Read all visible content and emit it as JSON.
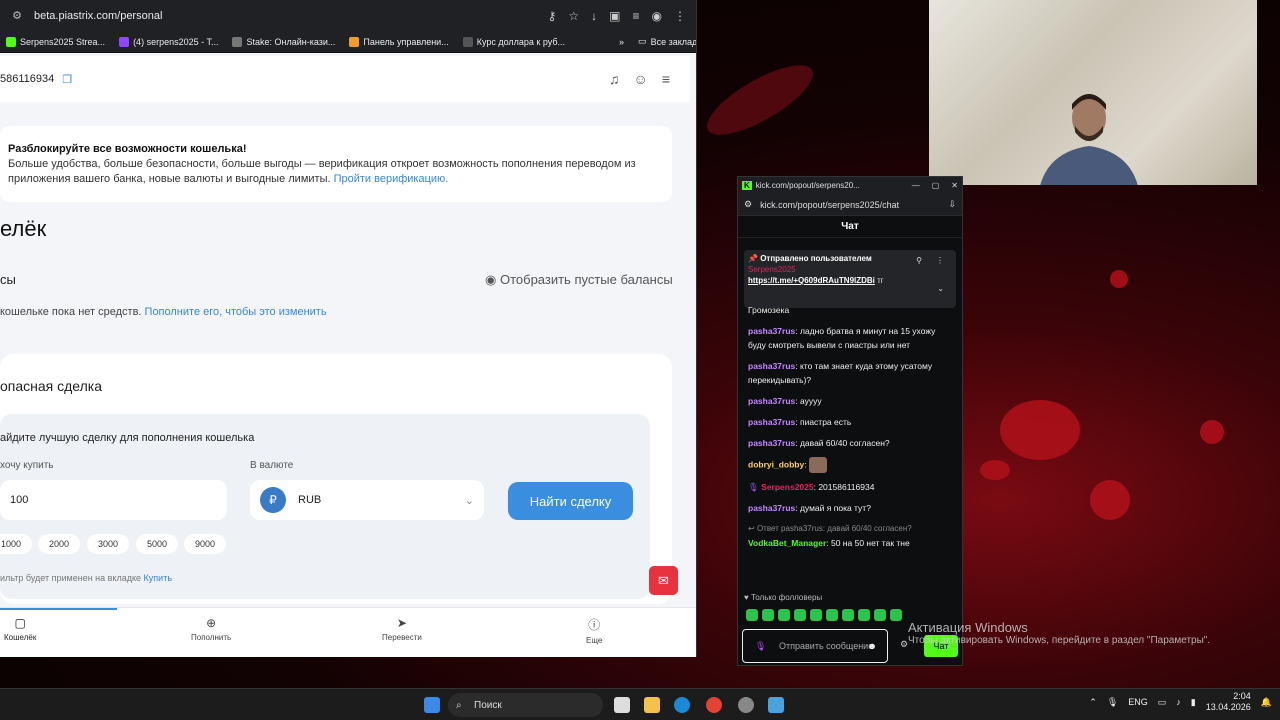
{
  "browser": {
    "url": "beta.piastrix.com/personal",
    "bookmarks": [
      {
        "label": "Serpens2025 Strea...",
        "color": "#53fc18"
      },
      {
        "label": "(4) serpens2025 - T...",
        "color": "#9146ff"
      },
      {
        "label": "Stake: Онлайн-кази...",
        "color": "#1a2c38"
      },
      {
        "label": "Панель управлени...",
        "color": "#f29d2c"
      },
      {
        "label": "Курс доллара к руб...",
        "color": "#333333"
      }
    ],
    "all_bookmarks": "Все закладки"
  },
  "wallet": {
    "account_id": "586116934",
    "banner_title": "Разблокируйте все возможности кошелька!",
    "banner_text": "Больше удобства, больше безопасности, больше выгоды — верификация откроет возможность пополнения переводом из приложения вашего банка, новые валюты и выгодные лимиты.",
    "banner_link": "Пройти верификацию.",
    "heading": "елёк",
    "balances_title": "сы",
    "show_empty": "Отобразить пустые балансы",
    "empty_text": "кошельке пока нет средств.",
    "empty_link": "Пополните его, чтобы это изменить",
    "safe_deal": "опасная сделка",
    "find_best": "айдите лучшую сделку для пополнения кошелька",
    "want_buy": "хочу купить",
    "in_currency": "В валюте",
    "amount": "100",
    "currency": "RUB",
    "find_button": "Найти сделку",
    "chips": [
      "1000",
      "2000",
      "3000",
      "5000",
      "9000"
    ],
    "filter_note": "ильтр будет применен на вкладке",
    "filter_link": "Купить",
    "nav": [
      "Кошелёк",
      "Пополнить",
      "Перевести",
      "Еще"
    ]
  },
  "chat": {
    "window_title": "kick.com/popout/serpens20...",
    "url": "kick.com/popout/serpens2025/chat",
    "header": "Чат",
    "pinned_by": "Отправлено пользователем",
    "pinned_user": "Serpens2025",
    "pinned_link": "https://t.me/+Q609dRAuTN9lZDBi",
    "pinned_suffix": "тг",
    "messages": [
      {
        "user": "",
        "text": "Громозека",
        "color": "#c586ff"
      },
      {
        "user": "pasha37rus",
        "text": ": ладно братва я минут на 15 ухожу буду смотреть вывели с пиастры или нет",
        "color": "#c586ff"
      },
      {
        "user": "pasha37rus",
        "text": ": кто там знает куда этому усатому перекидывать)?",
        "color": "#c586ff"
      },
      {
        "user": "pasha37rus",
        "text": ": ауууу",
        "color": "#c586ff"
      },
      {
        "user": "pasha37rus",
        "text": ": пиастра есть",
        "color": "#c586ff"
      },
      {
        "user": "pasha37rus",
        "text": ": давай 60/40 согласен?",
        "color": "#c586ff"
      },
      {
        "user": "dobryi_dobby",
        "text": ":",
        "color": "#ffd34d"
      },
      {
        "user": "Serpens2025",
        "text": ": 201586116934",
        "color": "#e0245e"
      },
      {
        "user": "pasha37rus",
        "text": ": думай я пока тут?",
        "color": "#c586ff"
      }
    ],
    "reply_to": "Ответ pasha37rus: давай 60/40 согласен?",
    "reply_user": "VodkaBet_Manager",
    "reply_text": ": 50 на 50 нет так тне",
    "followers_only": "Только фолловеры",
    "input_placeholder": "Отправить сообщение",
    "send_button": "Чат"
  },
  "watermark": {
    "title": "Активация Windows",
    "text": "Чтобы активировать Windows, перейдите в раздел \"Параметры\"."
  },
  "taskbar": {
    "search": "Поиск",
    "lang": "ENG",
    "time": "2:04",
    "date": "13.04.2026"
  }
}
